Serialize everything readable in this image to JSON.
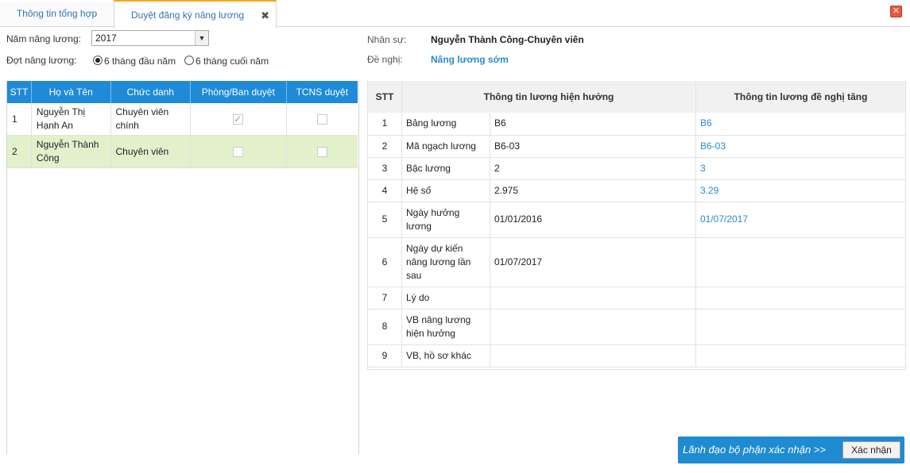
{
  "tabs": [
    {
      "label": "Thông tin tổng hợp"
    },
    {
      "label": "Duyệt đăng ký nâng lương",
      "close": "✖"
    }
  ],
  "window_close": "✕",
  "filter": {
    "year_label": "Năm nâng lương:",
    "year_value": "2017",
    "period_label": "Đợt nâng lương:",
    "period_options": [
      {
        "label": "6 tháng đầu năm",
        "selected": true
      },
      {
        "label": "6 tháng cuối năm",
        "selected": false
      }
    ]
  },
  "staff_table": {
    "headers": [
      "STT",
      "Họ và Tên",
      "Chức danh",
      "Phòng/Ban duyệt",
      "TCNS duyệt"
    ],
    "rows": [
      {
        "stt": "1",
        "name": "Nguyễn Thị Hạnh An",
        "title": "Chuyên viên chính",
        "dept_approved": true,
        "tcns_approved": false,
        "selected": false
      },
      {
        "stt": "2",
        "name": "Nguyễn Thành Công",
        "title": "Chuyên viên",
        "dept_approved": false,
        "tcns_approved": false,
        "selected": true
      }
    ]
  },
  "info": {
    "staff_label": "Nhân sự:",
    "staff_value": "Nguyễn Thành Công-Chuyên viên",
    "proposal_label": "Đề nghị:",
    "proposal_value": "Nâng lương sớm"
  },
  "salary_table": {
    "headers": [
      "STT",
      "Thông tin lương hiện hưởng",
      "Thông tin lương đề nghị tăng"
    ],
    "rows": [
      {
        "stt": "1",
        "field": "Bảng lương",
        "current": "B6",
        "proposed": "B6"
      },
      {
        "stt": "2",
        "field": "Mã ngạch lương",
        "current": "B6-03",
        "proposed": "B6-03"
      },
      {
        "stt": "3",
        "field": "Bậc lương",
        "current": "2",
        "proposed": "3"
      },
      {
        "stt": "4",
        "field": "Hệ số",
        "current": "2.975",
        "proposed": "3.29"
      },
      {
        "stt": "5",
        "field": "Ngày hưởng lương",
        "current": "01/01/2016",
        "proposed": "01/07/2017"
      },
      {
        "stt": "6",
        "field": "Ngày dự kiến nâng lương lần sau",
        "current": "01/07/2017",
        "proposed": ""
      },
      {
        "stt": "7",
        "field": "Lý do",
        "current": "",
        "proposed": ""
      },
      {
        "stt": "8",
        "field": "VB nâng lương hiện hưởng",
        "current": "",
        "proposed": ""
      },
      {
        "stt": "9",
        "field": "VB, hồ sơ khác",
        "current": "",
        "proposed": ""
      }
    ]
  },
  "footer": {
    "confirm_text": "Lãnh đạo bộ phận xác nhận >>",
    "confirm_button": "Xác nhận"
  },
  "colors": {
    "header_blue": "#1f8ad8",
    "link_blue": "#2a8ad0",
    "selected_row": "#e3f0cc",
    "active_tab_accent": "#f5a623"
  }
}
